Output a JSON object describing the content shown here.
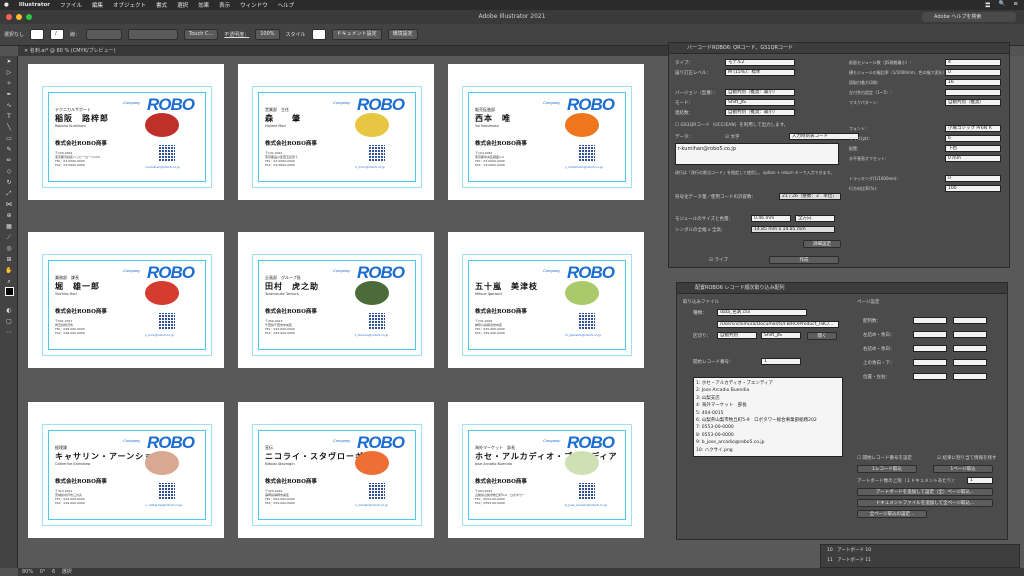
{
  "menubar": {
    "apple": "",
    "items": [
      "Illustrator",
      "ファイル",
      "編集",
      "オブジェクト",
      "書式",
      "選択",
      "効果",
      "表示",
      "ウィンドウ",
      "ヘルプ"
    ],
    "right": [
      "〓",
      "🔍",
      "≡"
    ]
  },
  "titlebar": {
    "title": "Adobe Illustrator 2021",
    "search_placeholder": "Adobe ヘルプを検索"
  },
  "control": {
    "selection": "選択なし",
    "stroke_label": "線：",
    "brush": "Touch C...",
    "opacity_label": "不透明度：",
    "opacity": "100%",
    "style_label": "スタイル",
    "doc_settings": "ドキュメント設定",
    "env_settings": "環境設定"
  },
  "tab": {
    "label": "名刺.ai* @ 80 % (CMYK/プレビュー)"
  },
  "cards": [
    {
      "title": "テクニカルサポート",
      "name": "稲阪　路梓郎",
      "roman": "Robono Kumiham",
      "fruit": "#c0302a",
      "dept": "",
      "addr": [
        "〒100-0001",
        "東京都渋谷区ハッピーロード123",
        "TEL：03-0000-0000",
        "FAX：03-0000-0000"
      ],
      "mail": "r-kumihan@robo5.co.jp"
    },
    {
      "title": "営業部　主任",
      "name": "森　　肇",
      "roman": "Hajime Mori",
      "fruit": "#e7c641",
      "dept": "",
      "addr": [
        "〒141-0021",
        "東京都品川区西五反田１",
        "TEL：03-0000-0000",
        "FAX：03-0000-0000"
      ],
      "mail": "h_mori@robo5.co.jp"
    },
    {
      "title": "販売促進部",
      "name": "西本　唯",
      "roman": "Yui Nishimoto",
      "fruit": "#f0761e",
      "dept": "",
      "addr": [
        "〒104-0061",
        "東京都中央区銀座1-2",
        "TEL：03-0000-0000",
        "FAX：03-0000-0000"
      ],
      "mail": "y_nishimoto@robo5.co.jp"
    },
    {
      "title": "業務部　課長",
      "name": "堀　雄一郎",
      "roman": "Yuichiro Hori",
      "fruit": "#d63b2f",
      "dept": "",
      "addr": [
        "〒501-0017",
        "埼玉県所沢市",
        "TEL：048-000-0000",
        "FAX：048-000-0000"
      ],
      "mail": "y_hori@robo5.co.jp"
    },
    {
      "title": "企画部　グループ長",
      "name": "田村　虎之助",
      "roman": "Toranosuke Tamura",
      "fruit": "#4c6b3a",
      "dept": "",
      "addr": [
        "〒260-0013",
        "千葉県千葉市中央区",
        "TEL：043-000-0000",
        "FAX：043-000-0000"
      ],
      "mail": "t_tamura@robo5.co.jp"
    },
    {
      "title": "",
      "name": "五十嵐　美津枝",
      "roman": "Mitsue Igarashi",
      "fruit": "#a9c96a",
      "dept": "",
      "addr": [
        "〒231-0007",
        "神奈川県横浜市中区",
        "TEL：045-000-0000",
        "FAX：045-000-0000"
      ],
      "mail": "m_igarashi@robo5.co.jp"
    },
    {
      "title": "経理課",
      "name": "キャサリン・アーンショー",
      "roman": "Catherine Earnshaw",
      "fruit": "#d8a890",
      "dept": "",
      "addr": [
        "〒310-0011",
        "茨城県水戸市三の丸",
        "TEL：029-000-0000",
        "FAX：029-000-0000"
      ],
      "mail": "c_catherine@robo5.co.jp"
    },
    {
      "title": "宣伝",
      "name": "ニコライ・スタヴローギン",
      "roman": "Nikolai Stavrogin",
      "fruit": "#ef6e33",
      "dept": "",
      "addr": [
        "〒420-0042",
        "静岡県静岡市葵区",
        "TEL：054-000-0000",
        "FAX：054-000-0000"
      ],
      "mail": "n_nikolai@robo5.co.jp"
    },
    {
      "title": "海外マーケット　部長",
      "name": "ホセ・アルカディオ・ブエンディア",
      "roman": "Jose Arcadio Buendia",
      "fruit": "#cfe0b4",
      "dept": "",
      "addr": [
        "〒404-0015",
        "山梨県山梨市牧丘町5-9　ロボタワー",
        "TEL：0553-00-0000",
        "FAX：0553-00-0000"
      ],
      "mail": "b_jose_arcadio@robo5.co.jp"
    }
  ],
  "card_common": {
    "company_label": "Company",
    "logo": "ROBO",
    "company": "株式会社ROBO商事"
  },
  "barcode_panel": {
    "title": "バーコードROBO6: QRコード、GS1QRコード",
    "type_label": "タイプ：",
    "type": "モデル2",
    "ecc_label": "誤り訂正レベル：",
    "ecc": "M (15%)：標準",
    "version_label": "バージョン（型番）：",
    "version": "自動判別（推奨：最小）",
    "mode_label": "モード：",
    "mode": "Shift_JIS",
    "connect_label": "連結数：",
    "connect": "自動判別（推奨：最小）",
    "gs1_label": "GS1QRコード（UCC/EAN）を利用して出力します。",
    "data_label": "データ：",
    "text_label": "文字",
    "data_mode": "入力時刻表コード",
    "data_value": "r-kumihan@robo5.co.jp",
    "note": "改行は「改行の割当コード」を指定して使用し、option + return キーで入力できます。",
    "module_label": "モジュールのサイズと色量：",
    "module_size": "0.46 mm",
    "module_unit": "全方向",
    "symbol_label": "シンボルの全幅 x 全高：",
    "symbol_size": "14.85 mm x 14.85 mm",
    "count_label": "符号化データ量／使用コードの許容数：",
    "count": "21 / 26（整数：3　単位）",
    "right_labels": [
      "前面モジュール数（JIS規格最小）：",
      "横モジュールの幅比率（1/1000mm、色の幅で変化）：",
      "読取付着大印刷：",
      "左付余白設定（1～5）：",
      "マスクパターン：",
      "フォント：",
      "サイズ(pt)：",
      "配置：",
      "水平垂直オフセット：",
      "トラッキング(1/1000em)：",
      "行方向比率(%)："
    ],
    "right_values": [
      "4",
      "0",
      "16",
      "",
      "自動判別（推奨）",
      "小塚ゴシック Pr6N R",
      "6",
      "下右",
      "0 mm",
      "0",
      "100"
    ],
    "detail_button": "詳細設定",
    "live_label": "ライブ",
    "create_button": "作成"
  },
  "batch_panel": {
    "title": "配置ROBO6 レコード順次取り込み配列",
    "file_label": "取り込みファイル",
    "tab_label": "種類：",
    "tab_value": "data_名刺.csv",
    "path": "/Users/ichimura/Documents/FB/RO/Product_FBC/...",
    "delimiter_label": "区切り：",
    "delimiter": "自動判別",
    "encoding": "Shift_JIS",
    "read_button": "開く",
    "start_label": "開始レコード番号：",
    "start": "1",
    "list": [
      "1: ホセ・アルカディオ・ブエンディア",
      "2: Jose Arcadio Buendia",
      "3: 山梨支店",
      "4: 海外マーケット　部長",
      "5: 404-0015",
      "6: 山梨県山梨市牧丘町5-9　ロボタワー総合事業部総務202",
      "7: 0553-00-0000",
      "8: 0553-00-0000",
      "9: b_jose_arcadio@robo5.co.jp",
      "10: ハクサイ.png"
    ],
    "order_label": "ページ設定",
    "order_right": [
      "配列数：",
      "左詰め・余白：",
      "右詰め・余白：",
      "上の余白・下：",
      "位置・左右："
    ],
    "buttons": [
      "1レコード取込",
      "1ページ取込",
      "アートボードを追加して設定（全）ページ取込...",
      "ドキュメントファイルを追加して全ページ取込...",
      "全ページ取込の設定..."
    ],
    "checkbox1": "開始レコード番号を設定",
    "checkbox2": "結果に割り当て情報を残す",
    "artboard_label": "アートボード数の上限（１ドキュメントあたり）：",
    "artboard_max": "1"
  },
  "layers": [
    {
      "num": "10",
      "name": "アートボード 10"
    },
    {
      "num": "11",
      "name": "アートボード 11"
    }
  ],
  "status": {
    "zoom": "80%",
    "rotate": "0°",
    "page": "6",
    "mode": "選択"
  }
}
